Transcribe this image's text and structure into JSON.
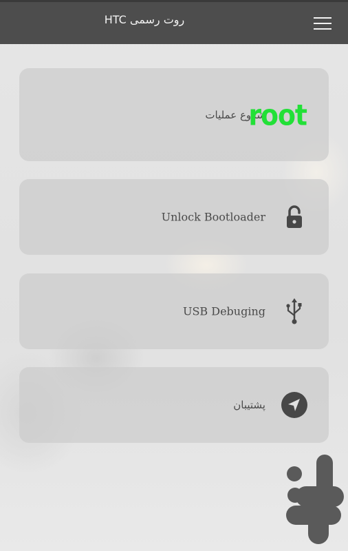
{
  "header": {
    "title": "روت رسمی HTC",
    "menu_icon": "hamburger-menu-icon"
  },
  "cards": [
    {
      "label": "شروع عملیات",
      "badge": "root",
      "badge_color": "#22e037"
    },
    {
      "label": "Unlock Bootloader",
      "icon": "unlock-icon"
    },
    {
      "label": "USB Debuging",
      "icon": "usb-icon"
    },
    {
      "label": "پشتیبان",
      "icon": "navigation-arrow-icon"
    }
  ],
  "colors": {
    "topbar": "#4d4d4d",
    "card": "#cccccc",
    "icon": "#474747",
    "root_green": "#22e037"
  },
  "watermark_icon": "bazaar-logo-icon"
}
